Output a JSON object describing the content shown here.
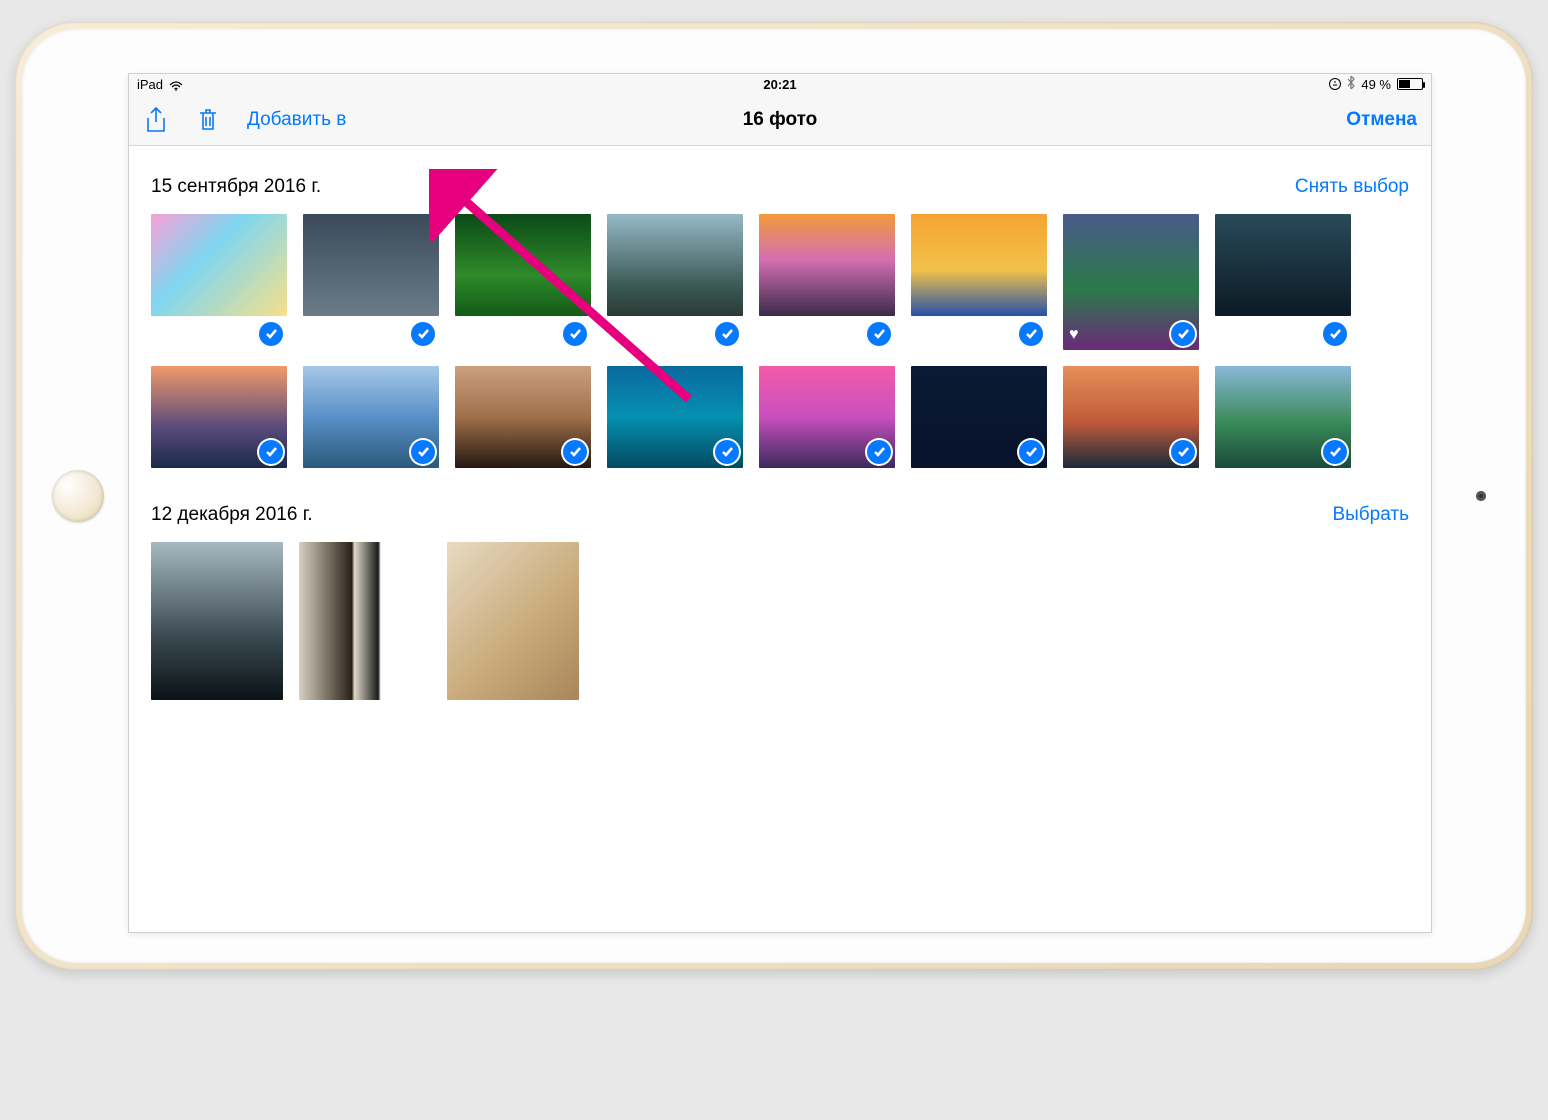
{
  "status": {
    "device": "iPad",
    "time": "20:21",
    "battery_text": "49 %"
  },
  "nav": {
    "add_to": "Добавить в",
    "title": "16 фото",
    "cancel": "Отмена"
  },
  "sections": [
    {
      "title": "15 сентября 2016 г.",
      "action": "Снять выбор",
      "photos": [
        {
          "g": "g1",
          "sel": true
        },
        {
          "g": "g2",
          "sel": true
        },
        {
          "g": "g3",
          "sel": true
        },
        {
          "g": "g4",
          "sel": true
        },
        {
          "g": "g5",
          "sel": true
        },
        {
          "g": "g6",
          "sel": true
        },
        {
          "g": "g7",
          "sel": true,
          "fav": true,
          "tall": true
        },
        {
          "g": "g8",
          "sel": true
        },
        {
          "g": "g9",
          "sel": true
        },
        {
          "g": "g10",
          "sel": true
        },
        {
          "g": "g11",
          "sel": true
        },
        {
          "g": "g12",
          "sel": true
        },
        {
          "g": "g13",
          "sel": true
        },
        {
          "g": "g14",
          "sel": true
        },
        {
          "g": "g15",
          "sel": true
        },
        {
          "g": "g16",
          "sel": true
        }
      ]
    },
    {
      "title": "12 декабря 2016 г.",
      "action": "Выбрать",
      "photos": [
        {
          "g": "g17",
          "sel": false,
          "big": true
        },
        {
          "g": "g18",
          "sel": false,
          "big": true
        },
        {
          "g": "g19",
          "sel": false,
          "big": true
        }
      ]
    }
  ]
}
